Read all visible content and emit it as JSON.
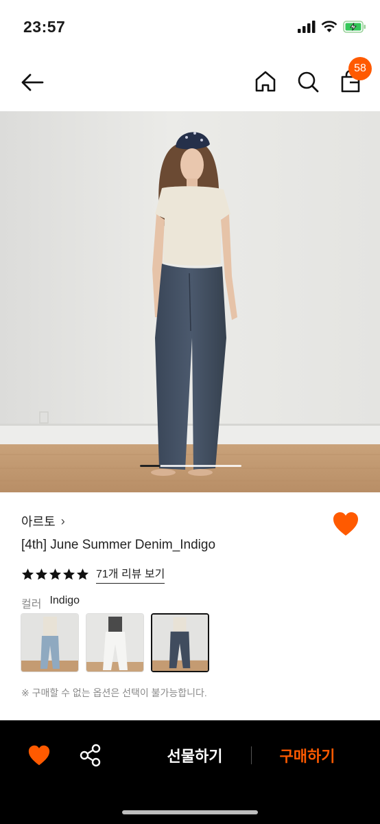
{
  "status_bar": {
    "time": "23:57"
  },
  "nav": {
    "cart_count": "58"
  },
  "carousel": {
    "position": 1,
    "progress": 0.2
  },
  "product": {
    "brand": "아르토",
    "brand_chevron": "›",
    "title": "[4th] June Summer Denim_Indigo",
    "rating_stars": 5,
    "review_link": "71개 리뷰 보기",
    "option_label": "컬러",
    "option_value": "Indigo",
    "color_options": [
      "light-blue-denim",
      "white",
      "indigo"
    ],
    "selected_option": "indigo",
    "notice": "※ 구매할 수 없는 옵션은 선택이 불가능합니다."
  },
  "bottom_bar": {
    "gift_label": "선물하기",
    "buy_label": "구매하기"
  },
  "colors": {
    "accent": "#ff5a00",
    "bottom_bar_bg": "#000000",
    "text": "#1a1a1a",
    "muted": "#888888"
  },
  "icons": [
    "signal-icon",
    "wifi-icon",
    "battery-icon",
    "back-arrow-icon",
    "home-icon",
    "search-icon",
    "cart-icon",
    "heart-icon",
    "star-icon",
    "share-icon"
  ]
}
